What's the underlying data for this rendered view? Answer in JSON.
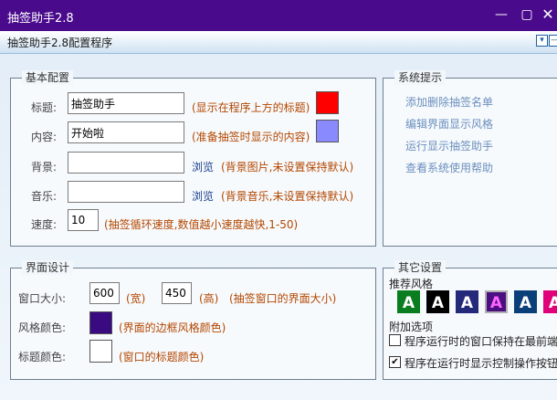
{
  "window": {
    "title": "抽签助手2.8"
  },
  "window_controls": {
    "minimize": "—",
    "maximize": "▢",
    "close": "✕"
  },
  "header": {
    "title": "抽签助手2.8配置程序",
    "dropdown_btn": "▾",
    "collapse_btn": "—"
  },
  "basic": {
    "legend": "基本配置",
    "title_label": "标题:",
    "title_value": "抽签助手",
    "title_hint": "(显示在程序上方的标题)",
    "title_color": "#ff0000",
    "content_label": "内容:",
    "content_value": "开始啦",
    "content_hint": "(准备抽签时显示的内容)",
    "content_color": "#8a8aff",
    "bg_label": "背景:",
    "bg_value": "",
    "bg_browse": "浏览",
    "bg_hint": "(背景图片,未设置保持默认)",
    "music_label": "音乐:",
    "music_value": "",
    "music_browse": "浏览",
    "music_hint": "(背景音乐,未设置保持默认)",
    "speed_label": "速度:",
    "speed_value": "10",
    "speed_hint": "(抽签循环速度,数值越小速度越快,1-50)"
  },
  "system": {
    "legend": "系统提示",
    "items": [
      "添加删除抽签名单",
      "编辑界面显示风格",
      "运行显示抽签助手",
      "查看系统使用帮助"
    ]
  },
  "ui": {
    "legend": "界面设计",
    "size_label": "窗口大小:",
    "width_value": "600",
    "width_unit": "(宽)",
    "height_value": "450",
    "height_unit": "(高)",
    "size_hint": "(抽签窗口的界面大小)",
    "border_label": "风格颜色:",
    "border_color": "#3a0a80",
    "border_hint": "(界面的边框风格颜色)",
    "titlecolor_label": "标题颜色:",
    "title_color": "#ffffff",
    "titlecolor_hint": "(窗口的标题颜色)"
  },
  "other": {
    "legend": "其它设置",
    "styles_label": "推荐风格",
    "styles": [
      {
        "letter": "A",
        "bg": "#0a7d1e",
        "border": "#0a7d1e",
        "fg": "#ffffff"
      },
      {
        "letter": "A",
        "bg": "#000000",
        "border": "#000000",
        "fg": "#ffffff"
      },
      {
        "letter": "A",
        "bg": "#24297a",
        "border": "#24297a",
        "fg": "#ffffff"
      },
      {
        "letter": "A",
        "bg": "#4b0f82",
        "border": "#b0b0b0",
        "fg": "#ff66ff"
      },
      {
        "letter": "A",
        "bg": "#0a3f7a",
        "border": "#0a3f7a",
        "fg": "#ffffff"
      },
      {
        "letter": "A",
        "bg": "#e0007a",
        "border": "#e0007a",
        "fg": "#ffffff"
      }
    ],
    "extra_label": "附加选项",
    "opt1": {
      "checked": false,
      "label": "程序运行时的窗口保持在最前端"
    },
    "opt2": {
      "checked": true,
      "label": "程序在运行时显示控制操作按钮"
    }
  }
}
